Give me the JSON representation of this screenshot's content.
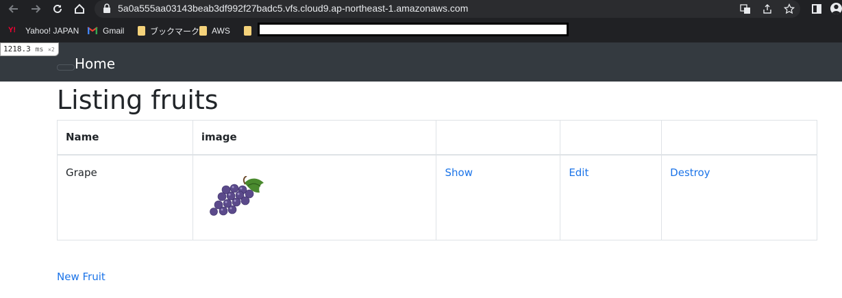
{
  "browser": {
    "url": "5a0a555aa03143beab3df992f27badc5.vfs.cloud9.ap-northeast-1.amazonaws.com",
    "bookmarks": [
      {
        "label": "Yahoo! JAPAN",
        "icon": "yahoo-icon"
      },
      {
        "label": "Gmail",
        "icon": "gmail-icon"
      },
      {
        "label": "ブックマーク",
        "icon": "folder-icon"
      },
      {
        "label": "AWS",
        "icon": "folder-icon"
      }
    ],
    "perf": {
      "value": "1218.3",
      "unit": "ms",
      "multiplier": "×2"
    }
  },
  "navbar": {
    "brand": "Home"
  },
  "page": {
    "title": "Listing fruits",
    "table": {
      "headers": [
        "Name",
        "image",
        "",
        "",
        ""
      ],
      "rows": [
        {
          "name": "Grape",
          "image": "grape-image",
          "show": "Show",
          "edit": "Edit",
          "destroy": "Destroy"
        }
      ]
    },
    "new_link": "New Fruit"
  },
  "colors": {
    "navbar_bg": "#343a40",
    "link": "#1a73e8",
    "chrome_bg": "#202124"
  }
}
